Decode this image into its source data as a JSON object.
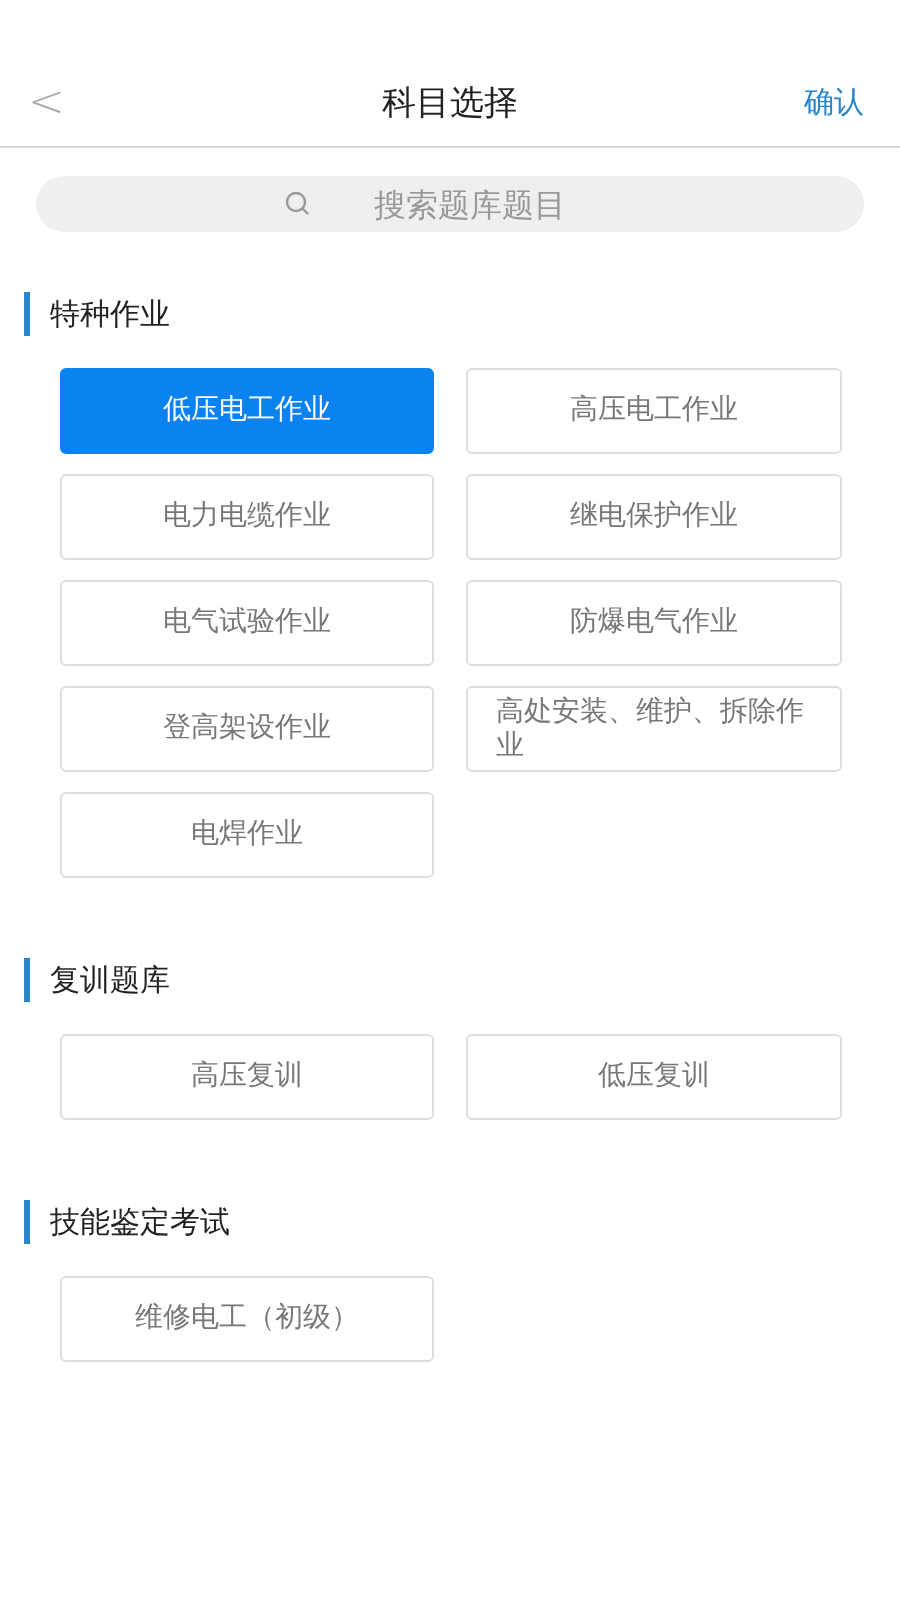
{
  "header": {
    "back": "<",
    "title": "科目选择",
    "confirm": "确认"
  },
  "search": {
    "placeholder": "搜索题库题目"
  },
  "sections": [
    {
      "title": "特种作业",
      "options": [
        {
          "label": "低压电工作业",
          "selected": true
        },
        {
          "label": "高压电工作业",
          "selected": false
        },
        {
          "label": "电力电缆作业",
          "selected": false
        },
        {
          "label": "继电保护作业",
          "selected": false
        },
        {
          "label": "电气试验作业",
          "selected": false
        },
        {
          "label": "防爆电气作业",
          "selected": false
        },
        {
          "label": "登高架设作业",
          "selected": false
        },
        {
          "label": "高处安装、维护、拆除作业",
          "selected": false
        },
        {
          "label": "电焊作业",
          "selected": false
        }
      ]
    },
    {
      "title": "复训题库",
      "options": [
        {
          "label": "高压复训",
          "selected": false
        },
        {
          "label": "低压复训",
          "selected": false
        }
      ]
    },
    {
      "title": "技能鉴定考试",
      "options": [
        {
          "label": "维修电工（初级）",
          "selected": false
        }
      ]
    }
  ]
}
